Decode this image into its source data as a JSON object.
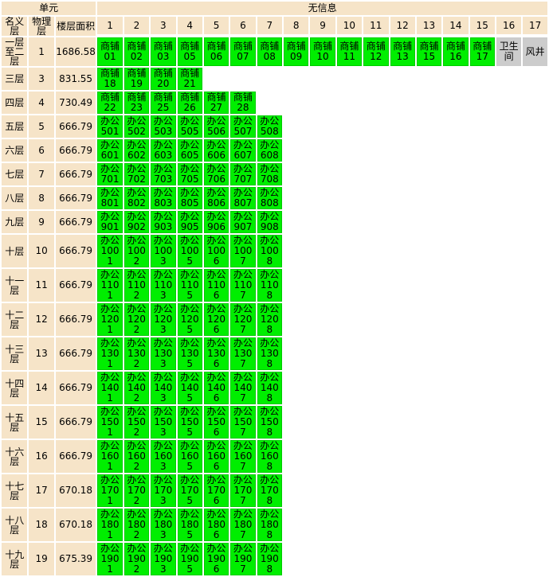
{
  "header": {
    "unit_label": "单元",
    "info_label": "无信息",
    "col_name": "名义层",
    "col_phys": "物理层",
    "col_area": "楼层面积",
    "numbers": [
      "1",
      "2",
      "3",
      "4",
      "5",
      "6",
      "7",
      "8",
      "9",
      "10",
      "11",
      "12",
      "13",
      "14",
      "15",
      "16",
      "17"
    ]
  },
  "rows": [
    {
      "name": "一层至二层",
      "phys": "1",
      "area": "1686.58",
      "cells": [
        {
          "t": "商铺01",
          "c": "g"
        },
        {
          "t": "商铺02",
          "c": "g"
        },
        {
          "t": "商铺03",
          "c": "g"
        },
        {
          "t": "商铺05",
          "c": "g"
        },
        {
          "t": "商铺06",
          "c": "g"
        },
        {
          "t": "商铺07",
          "c": "g"
        },
        {
          "t": "商铺08",
          "c": "g"
        },
        {
          "t": "商铺09",
          "c": "g"
        },
        {
          "t": "商铺10",
          "c": "g"
        },
        {
          "t": "商铺11",
          "c": "g"
        },
        {
          "t": "商铺12",
          "c": "g"
        },
        {
          "t": "商铺13",
          "c": "g"
        },
        {
          "t": "商铺15",
          "c": "g"
        },
        {
          "t": "商铺16",
          "c": "g"
        },
        {
          "t": "商铺17",
          "c": "g"
        },
        {
          "t": "卫生间",
          "c": "x"
        },
        {
          "t": "风井",
          "c": "x"
        }
      ]
    },
    {
      "name": "三层",
      "phys": "3",
      "area": "831.55",
      "cells": [
        {
          "t": "商铺18",
          "c": "g"
        },
        {
          "t": "商铺19",
          "c": "g"
        },
        {
          "t": "商铺20",
          "c": "g"
        },
        {
          "t": "商铺21",
          "c": "g"
        }
      ]
    },
    {
      "name": "四层",
      "phys": "4",
      "area": "730.49",
      "cells": [
        {
          "t": "商铺22",
          "c": "g"
        },
        {
          "t": "商铺23",
          "c": "g"
        },
        {
          "t": "商铺25",
          "c": "g"
        },
        {
          "t": "商铺26",
          "c": "g"
        },
        {
          "t": "商铺27",
          "c": "g"
        },
        {
          "t": "商铺28",
          "c": "g"
        }
      ]
    },
    {
      "name": "五层",
      "phys": "5",
      "area": "666.79",
      "cells": [
        {
          "t": "办公501",
          "c": "g"
        },
        {
          "t": "办公502",
          "c": "g"
        },
        {
          "t": "办公503",
          "c": "g"
        },
        {
          "t": "办公505",
          "c": "g"
        },
        {
          "t": "办公506",
          "c": "g"
        },
        {
          "t": "办公507",
          "c": "g"
        },
        {
          "t": "办公508",
          "c": "g"
        }
      ]
    },
    {
      "name": "六层",
      "phys": "6",
      "area": "666.79",
      "cells": [
        {
          "t": "办公601",
          "c": "g"
        },
        {
          "t": "办公602",
          "c": "g"
        },
        {
          "t": "办公603",
          "c": "g"
        },
        {
          "t": "办公605",
          "c": "g"
        },
        {
          "t": "办公606",
          "c": "g"
        },
        {
          "t": "办公607",
          "c": "g"
        },
        {
          "t": "办公608",
          "c": "g"
        }
      ]
    },
    {
      "name": "七层",
      "phys": "7",
      "area": "666.79",
      "cells": [
        {
          "t": "办公701",
          "c": "g"
        },
        {
          "t": "办公702",
          "c": "g"
        },
        {
          "t": "办公703",
          "c": "g"
        },
        {
          "t": "办公705",
          "c": "g"
        },
        {
          "t": "办公706",
          "c": "g"
        },
        {
          "t": "办公707",
          "c": "g"
        },
        {
          "t": "办公708",
          "c": "g"
        }
      ]
    },
    {
      "name": "八层",
      "phys": "8",
      "area": "666.79",
      "cells": [
        {
          "t": "办公801",
          "c": "g"
        },
        {
          "t": "办公802",
          "c": "g"
        },
        {
          "t": "办公803",
          "c": "g"
        },
        {
          "t": "办公805",
          "c": "g"
        },
        {
          "t": "办公806",
          "c": "g"
        },
        {
          "t": "办公807",
          "c": "g"
        },
        {
          "t": "办公808",
          "c": "g"
        }
      ]
    },
    {
      "name": "九层",
      "phys": "9",
      "area": "666.79",
      "cells": [
        {
          "t": "办公901",
          "c": "g"
        },
        {
          "t": "办公902",
          "c": "g"
        },
        {
          "t": "办公903",
          "c": "g"
        },
        {
          "t": "办公905",
          "c": "g"
        },
        {
          "t": "办公906",
          "c": "g"
        },
        {
          "t": "办公907",
          "c": "g"
        },
        {
          "t": "办公908",
          "c": "g"
        }
      ]
    },
    {
      "name": "十层",
      "phys": "10",
      "area": "666.79",
      "cells": [
        {
          "t": "办公1001",
          "c": "g"
        },
        {
          "t": "办公1002",
          "c": "g"
        },
        {
          "t": "办公1003",
          "c": "g"
        },
        {
          "t": "办公1005",
          "c": "g"
        },
        {
          "t": "办公1006",
          "c": "g"
        },
        {
          "t": "办公1007",
          "c": "g"
        },
        {
          "t": "办公1008",
          "c": "g"
        }
      ]
    },
    {
      "name": "十一层",
      "phys": "11",
      "area": "666.79",
      "cells": [
        {
          "t": "办公1101",
          "c": "g"
        },
        {
          "t": "办公1102",
          "c": "g"
        },
        {
          "t": "办公1103",
          "c": "g"
        },
        {
          "t": "办公1105",
          "c": "g"
        },
        {
          "t": "办公1106",
          "c": "g"
        },
        {
          "t": "办公1107",
          "c": "g"
        },
        {
          "t": "办公1108",
          "c": "g"
        }
      ]
    },
    {
      "name": "十二层",
      "phys": "12",
      "area": "666.79",
      "cells": [
        {
          "t": "办公1201",
          "c": "g"
        },
        {
          "t": "办公1202",
          "c": "g"
        },
        {
          "t": "办公1203",
          "c": "g"
        },
        {
          "t": "办公1205",
          "c": "g"
        },
        {
          "t": "办公1206",
          "c": "g"
        },
        {
          "t": "办公1207",
          "c": "g"
        },
        {
          "t": "办公1208",
          "c": "g"
        }
      ]
    },
    {
      "name": "十三层",
      "phys": "13",
      "area": "666.79",
      "cells": [
        {
          "t": "办公1301",
          "c": "g"
        },
        {
          "t": "办公1302",
          "c": "g"
        },
        {
          "t": "办公1303",
          "c": "g"
        },
        {
          "t": "办公1305",
          "c": "g"
        },
        {
          "t": "办公1306",
          "c": "g"
        },
        {
          "t": "办公1307",
          "c": "g"
        },
        {
          "t": "办公1308",
          "c": "g"
        }
      ]
    },
    {
      "name": "十四层",
      "phys": "14",
      "area": "666.79",
      "cells": [
        {
          "t": "办公1401",
          "c": "g"
        },
        {
          "t": "办公1402",
          "c": "g"
        },
        {
          "t": "办公1403",
          "c": "g"
        },
        {
          "t": "办公1405",
          "c": "g"
        },
        {
          "t": "办公1406",
          "c": "g"
        },
        {
          "t": "办公1407",
          "c": "g"
        },
        {
          "t": "办公1408",
          "c": "g"
        }
      ]
    },
    {
      "name": "十五层",
      "phys": "15",
      "area": "666.79",
      "cells": [
        {
          "t": "办公1501",
          "c": "g"
        },
        {
          "t": "办公1502",
          "c": "g"
        },
        {
          "t": "办公1503",
          "c": "g"
        },
        {
          "t": "办公1505",
          "c": "g"
        },
        {
          "t": "办公1506",
          "c": "g"
        },
        {
          "t": "办公1507",
          "c": "g"
        },
        {
          "t": "办公1508",
          "c": "g"
        }
      ]
    },
    {
      "name": "十六层",
      "phys": "16",
      "area": "666.79",
      "cells": [
        {
          "t": "办公1601",
          "c": "g"
        },
        {
          "t": "办公1602",
          "c": "g"
        },
        {
          "t": "办公1603",
          "c": "g"
        },
        {
          "t": "办公1605",
          "c": "g"
        },
        {
          "t": "办公1606",
          "c": "g"
        },
        {
          "t": "办公1607",
          "c": "g"
        },
        {
          "t": "办公1608",
          "c": "g"
        }
      ]
    },
    {
      "name": "十七层",
      "phys": "17",
      "area": "670.18",
      "cells": [
        {
          "t": "办公1701",
          "c": "g"
        },
        {
          "t": "办公1702",
          "c": "g"
        },
        {
          "t": "办公1703",
          "c": "g"
        },
        {
          "t": "办公1705",
          "c": "g"
        },
        {
          "t": "办公1706",
          "c": "g"
        },
        {
          "t": "办公1707",
          "c": "g"
        },
        {
          "t": "办公1708",
          "c": "g"
        }
      ]
    },
    {
      "name": "十八层",
      "phys": "18",
      "area": "670.18",
      "cells": [
        {
          "t": "办公1801",
          "c": "g"
        },
        {
          "t": "办公1802",
          "c": "g"
        },
        {
          "t": "办公1803",
          "c": "g"
        },
        {
          "t": "办公1805",
          "c": "g"
        },
        {
          "t": "办公1806",
          "c": "g"
        },
        {
          "t": "办公1807",
          "c": "g"
        },
        {
          "t": "办公1808",
          "c": "g"
        }
      ]
    },
    {
      "name": "十九层",
      "phys": "19",
      "area": "675.39",
      "cells": [
        {
          "t": "办公1901",
          "c": "g"
        },
        {
          "t": "办公1902",
          "c": "g"
        },
        {
          "t": "办公1903",
          "c": "g"
        },
        {
          "t": "办公1905",
          "c": "g"
        },
        {
          "t": "办公1906",
          "c": "g"
        },
        {
          "t": "办公1907",
          "c": "g"
        },
        {
          "t": "办公1908",
          "c": "g"
        }
      ]
    }
  ],
  "colors": {
    "unit_green": "#00ee00",
    "header_tan": "#f6e4c8",
    "facility_gray": "#cccccc"
  }
}
